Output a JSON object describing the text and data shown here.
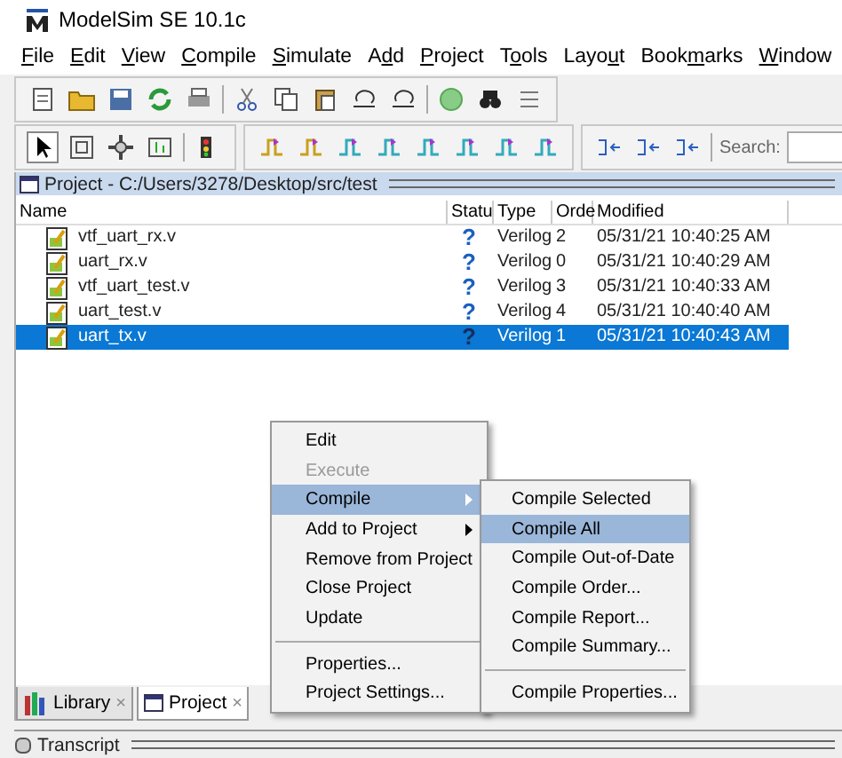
{
  "window": {
    "title": "ModelSim SE 10.1c"
  },
  "menu_bar": [
    {
      "access_key": "F",
      "after": "ile"
    },
    {
      "access_key": "E",
      "after": "dit"
    },
    {
      "access_key": "V",
      "after": "iew"
    },
    {
      "access_key": "C",
      "after": "ompile"
    },
    {
      "access_key": "S",
      "after": "imulate"
    },
    {
      "before": "A",
      "access_key": "d",
      "after": "d"
    },
    {
      "access_key": "P",
      "after": "roject"
    },
    {
      "before": "T",
      "access_key": "o",
      "after": "ols"
    },
    {
      "before": "Layo",
      "access_key": "u",
      "after": "t"
    },
    {
      "before": "Book",
      "access_key": "m",
      "after": "arks"
    },
    {
      "access_key": "W",
      "after": "indow"
    }
  ],
  "search": {
    "label": "Search:"
  },
  "project_panel": {
    "title": "Project - C:/Users/3278/Desktop/src/test",
    "columns": [
      "Name",
      "Statu",
      "Type",
      "Orde",
      "Modified"
    ],
    "rows": [
      {
        "name": "vtf_uart_rx.v",
        "status": "?",
        "type": "Verilog",
        "order": "2",
        "modified": "05/31/21 10:40:25 AM",
        "selected": false
      },
      {
        "name": "uart_rx.v",
        "status": "?",
        "type": "Verilog",
        "order": "0",
        "modified": "05/31/21 10:40:29 AM",
        "selected": false
      },
      {
        "name": "vtf_uart_test.v",
        "status": "?",
        "type": "Verilog",
        "order": "3",
        "modified": "05/31/21 10:40:33 AM",
        "selected": false
      },
      {
        "name": "uart_test.v",
        "status": "?",
        "type": "Verilog",
        "order": "4",
        "modified": "05/31/21 10:40:40 AM",
        "selected": false
      },
      {
        "name": "uart_tx.v",
        "status": "?",
        "type": "Verilog",
        "order": "1",
        "modified": "05/31/21 10:40:43 AM",
        "selected": true
      }
    ]
  },
  "context_menu": {
    "groups": [
      [
        {
          "label": "Edit",
          "disabled": false,
          "highlighted": false,
          "submenu": false
        },
        {
          "label": "Execute",
          "disabled": true,
          "highlighted": false,
          "submenu": false
        },
        {
          "label": "Compile",
          "disabled": false,
          "highlighted": true,
          "submenu": true
        },
        {
          "label": "Add to Project",
          "disabled": false,
          "highlighted": false,
          "submenu": true
        },
        {
          "label": "Remove from Project",
          "disabled": false,
          "highlighted": false,
          "submenu": false
        },
        {
          "label": "Close Project",
          "disabled": false,
          "highlighted": false,
          "submenu": false
        },
        {
          "label": "Update",
          "disabled": false,
          "highlighted": false,
          "submenu": false
        }
      ],
      [
        {
          "label": "Properties...",
          "disabled": false,
          "highlighted": false,
          "submenu": false
        },
        {
          "label": "Project Settings...",
          "disabled": false,
          "highlighted": false,
          "submenu": false
        }
      ]
    ]
  },
  "submenu": {
    "groups": [
      [
        {
          "label": "Compile Selected",
          "highlighted": false
        },
        {
          "label": "Compile All",
          "highlighted": true
        },
        {
          "label": "Compile Out-of-Date",
          "highlighted": false
        },
        {
          "label": "Compile Order...",
          "highlighted": false
        },
        {
          "label": "Compile Report...",
          "highlighted": false
        },
        {
          "label": "Compile Summary...",
          "highlighted": false
        }
      ],
      [
        {
          "label": "Compile Properties...",
          "highlighted": false
        }
      ]
    ]
  },
  "tabs": [
    {
      "label": "Library",
      "selected": false,
      "close": "×"
    },
    {
      "label": "Project",
      "selected": true,
      "close": "×"
    }
  ],
  "transcript": {
    "title": "Transcript"
  }
}
